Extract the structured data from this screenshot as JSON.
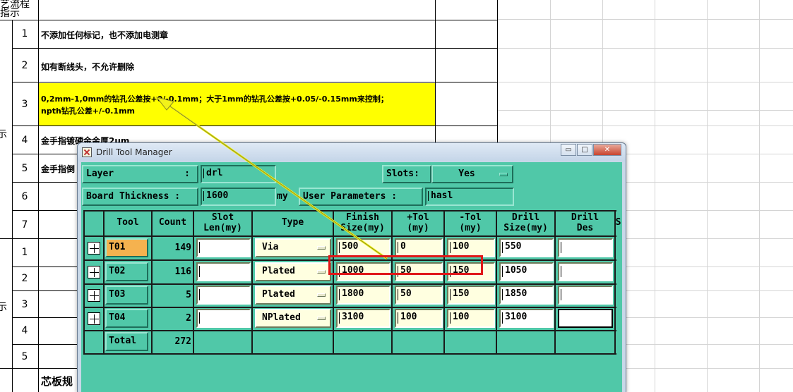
{
  "sheet": {
    "header_partial": "指示",
    "header_partial_top": "艺流程",
    "rows_top": [
      {
        "num": "1",
        "text": "不添加任何标记，也不添加电测章"
      },
      {
        "num": "2",
        "text": "如有断线头，不允许删除"
      },
      {
        "num": "3",
        "text_line1": "0,2mm-1,0mm的钻孔公差按+0/-0.1mm；大于1mm的钻孔公差按+0.05/-0.15mm来控制；",
        "text_line2": "npth钻孔公差+/-0.1mm"
      },
      {
        "num": "4",
        "text": "金手指镀硬金金厚2um"
      },
      {
        "num": "5",
        "text": "金手指倒"
      },
      {
        "num": "6",
        "text": ""
      },
      {
        "num": "7",
        "text": ""
      }
    ],
    "rows_bottom": [
      {
        "num": "1"
      },
      {
        "num": "2"
      },
      {
        "num": "3"
      },
      {
        "num": "4"
      },
      {
        "num": "5"
      }
    ],
    "side_chars": [
      "示",
      "示"
    ],
    "bottom_text": "芯板规"
  },
  "window": {
    "title": "Drill Tool Manager",
    "controls": {
      "minimize": "▭",
      "maximize": "□",
      "close": "✕"
    },
    "layer_label": "Layer",
    "layer_colon": ":",
    "layer_value": "drl",
    "slots_label": "Slots:",
    "slots_value": "Yes",
    "board_thickness_label": "Board Thickness :",
    "board_thickness_value": "1600",
    "board_thickness_unit": "my",
    "user_params_label": "User Parameters :",
    "user_params_value": "hasl",
    "columns": {
      "tool": "Tool",
      "count": "Count",
      "slot_len_1": "Slot",
      "slot_len_2": "Len(my)",
      "type": "Type",
      "finish_1": "Finish",
      "finish_2": "Size(my)",
      "ptol_1": "+Tol",
      "ptol_2": "(my)",
      "ntol_1": "-Tol",
      "ntol_2": "(my)",
      "drill_1": "Drill",
      "drill_2": "Size(my)",
      "des_1": "Drill",
      "des_2": "Des",
      "extra": "S"
    },
    "rows": [
      {
        "tool": "T01",
        "count": "149",
        "slot_len": "",
        "type": "Via",
        "finish": "500",
        "ptol": "0",
        "ntol": "100",
        "drill": "550",
        "des": ""
      },
      {
        "tool": "T02",
        "count": "116",
        "slot_len": "",
        "type": "Plated",
        "finish": "1000",
        "ptol": "50",
        "ntol": "150",
        "drill": "1050",
        "des": ""
      },
      {
        "tool": "T03",
        "count": "5",
        "slot_len": "",
        "type": "Plated",
        "finish": "1800",
        "ptol": "50",
        "ntol": "150",
        "drill": "1850",
        "des": ""
      },
      {
        "tool": "T04",
        "count": "2",
        "slot_len": "",
        "type": "NPlated",
        "finish": "3100",
        "ptol": "100",
        "ntol": "100",
        "drill": "3100",
        "des": ""
      }
    ],
    "total_label": "Total",
    "total_count": "272"
  },
  "colors": {
    "panel": "#50c8a8",
    "highlight_row": "#ffff00",
    "annotation_box": "#e01818",
    "selected_tool": "#f5b24f"
  }
}
